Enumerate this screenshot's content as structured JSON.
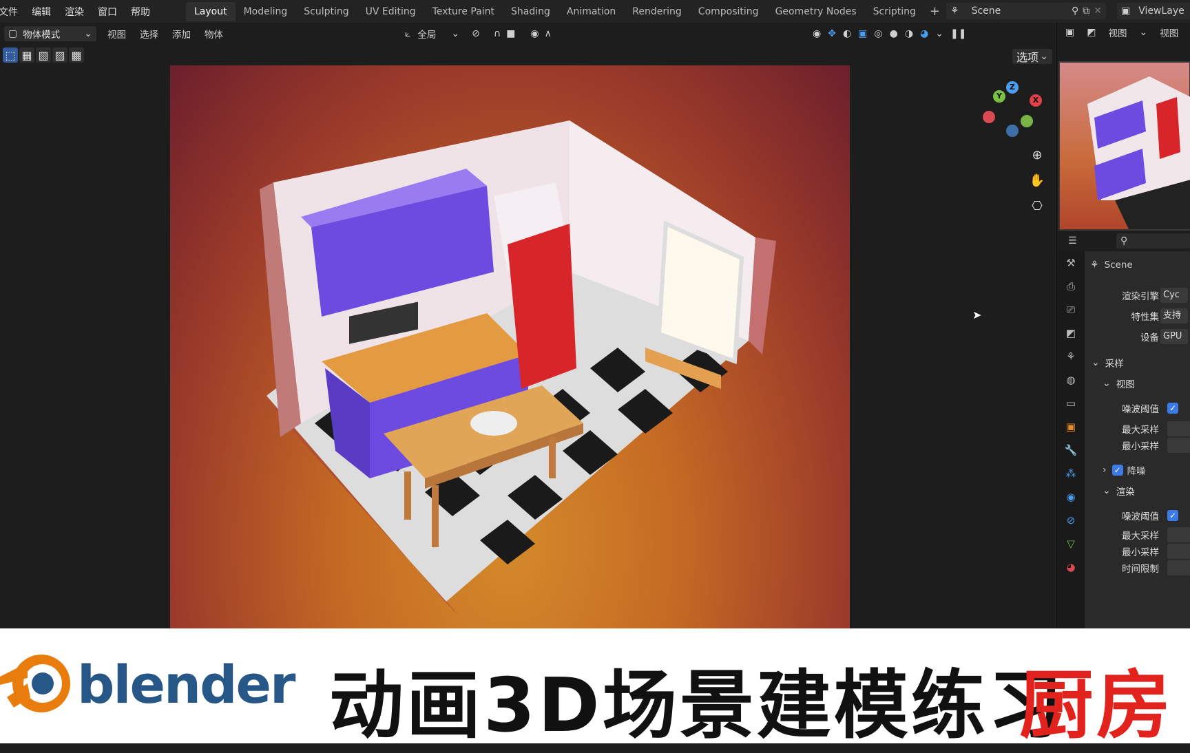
{
  "menu": [
    "文件",
    "编辑",
    "渲染",
    "窗口",
    "帮助"
  ],
  "workspaces": [
    "Layout",
    "Modeling",
    "Sculpting",
    "UV Editing",
    "Texture Paint",
    "Shading",
    "Animation",
    "Rendering",
    "Compositing",
    "Geometry Nodes",
    "Scripting"
  ],
  "active_workspace": "Layout",
  "scene_name": "Scene",
  "view_layer": "ViewLaye",
  "viewport_header": {
    "mode": "物体模式",
    "menus": [
      "视图",
      "选择",
      "添加",
      "物体"
    ],
    "transform_orientation": "全局",
    "options_label": "选项"
  },
  "right_header": {
    "view_label": "视图",
    "view2": "视图"
  },
  "gizmo": {
    "x": "X",
    "y": "Y",
    "z": "Z"
  },
  "properties": {
    "context": "Scene",
    "render_engine_label": "渲染引擎",
    "render_engine_value": "Cyc",
    "feature_set_label": "特性集",
    "feature_set_value": "支持",
    "device_label": "设备",
    "device_value": "GPU",
    "sampling_section": "采样",
    "viewport_subsection": "视图",
    "noise_threshold_label": "噪波阈值",
    "max_samples_label": "最大采样",
    "min_samples_label": "最小采样",
    "denoise_label": "降噪",
    "render_subsection": "渲染",
    "noise_threshold_label2": "噪波阈值",
    "max_samples_label2": "最大采样",
    "min_samples_label2": "最小采样",
    "time_limit_label": "时间限制"
  },
  "banner": {
    "logo_text": "blender",
    "title": "动画3D场景建模练习",
    "subtitle_red": "厨房"
  },
  "colors": {
    "accent_blue": "#3b7be8",
    "blender_orange": "#e87d0d",
    "blender_blue": "#265787",
    "title_red": "#e2231d"
  }
}
